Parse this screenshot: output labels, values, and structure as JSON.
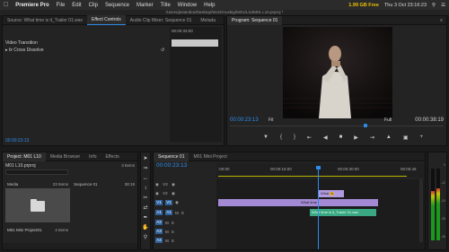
{
  "menubar": {
    "app": "Premiere Pro",
    "items": [
      "File",
      "Edit",
      "Clip",
      "Sequence",
      "Marker",
      "Title",
      "Window",
      "Help"
    ],
    "memory": "1.99 GB Free",
    "time": "Thu 3 Oct 23:16:23"
  },
  "path_bar": "/Users/jesterdeo/Desktop/Work/Ausbig/MO1/LIU/M01 L10.prproj *",
  "effect_controls": {
    "tabs": [
      "Source: What time is it_Trailer 01.wav",
      "Effect Controls",
      "Audio Clip Mixer: Sequence 01",
      "Metada"
    ],
    "row1": "Video Transition",
    "row2": "Cross Dissolve",
    "timeline_tc": "00:00:33:00",
    "timecode": "00:00:23:13"
  },
  "program_monitor": {
    "tab": "Program: Sequence 01",
    "timecode_left": "00:00:23:13",
    "fit": "Fit",
    "full": "Full",
    "timecode_right": "00:00:38:19"
  },
  "project": {
    "tabs": [
      "Project: M01 L10",
      "Media Browser",
      "Info",
      "Effects"
    ],
    "name": "M01 L10.prproj",
    "count": "3 Items",
    "tile1": {
      "head": "Media",
      "headr": "23 Items",
      "caption": "M01 Mini Project01",
      "captionr": "4 Items"
    },
    "tile2": {
      "head": "Sequence 01",
      "headr": "38:19"
    }
  },
  "timeline": {
    "tabs": [
      "Sequence 01",
      "M01 Mini Project"
    ],
    "timecode": "00:00:23:13",
    "ruler": [
      ":00:00",
      "00:00:15:00",
      "00:00:30:00",
      "00:00:45"
    ],
    "tracks": [
      "V3",
      "V2",
      "V1",
      "A1",
      "A2",
      "A3",
      "A4"
    ],
    "clips": {
      "v2_a": "What",
      "v2_b": "fx",
      "v1_label": "What time",
      "audio": "What time is it_Trailer 01.wav"
    }
  },
  "meters": {
    "scale": [
      "0",
      "-12",
      "-24",
      "-36",
      "-48"
    ]
  }
}
